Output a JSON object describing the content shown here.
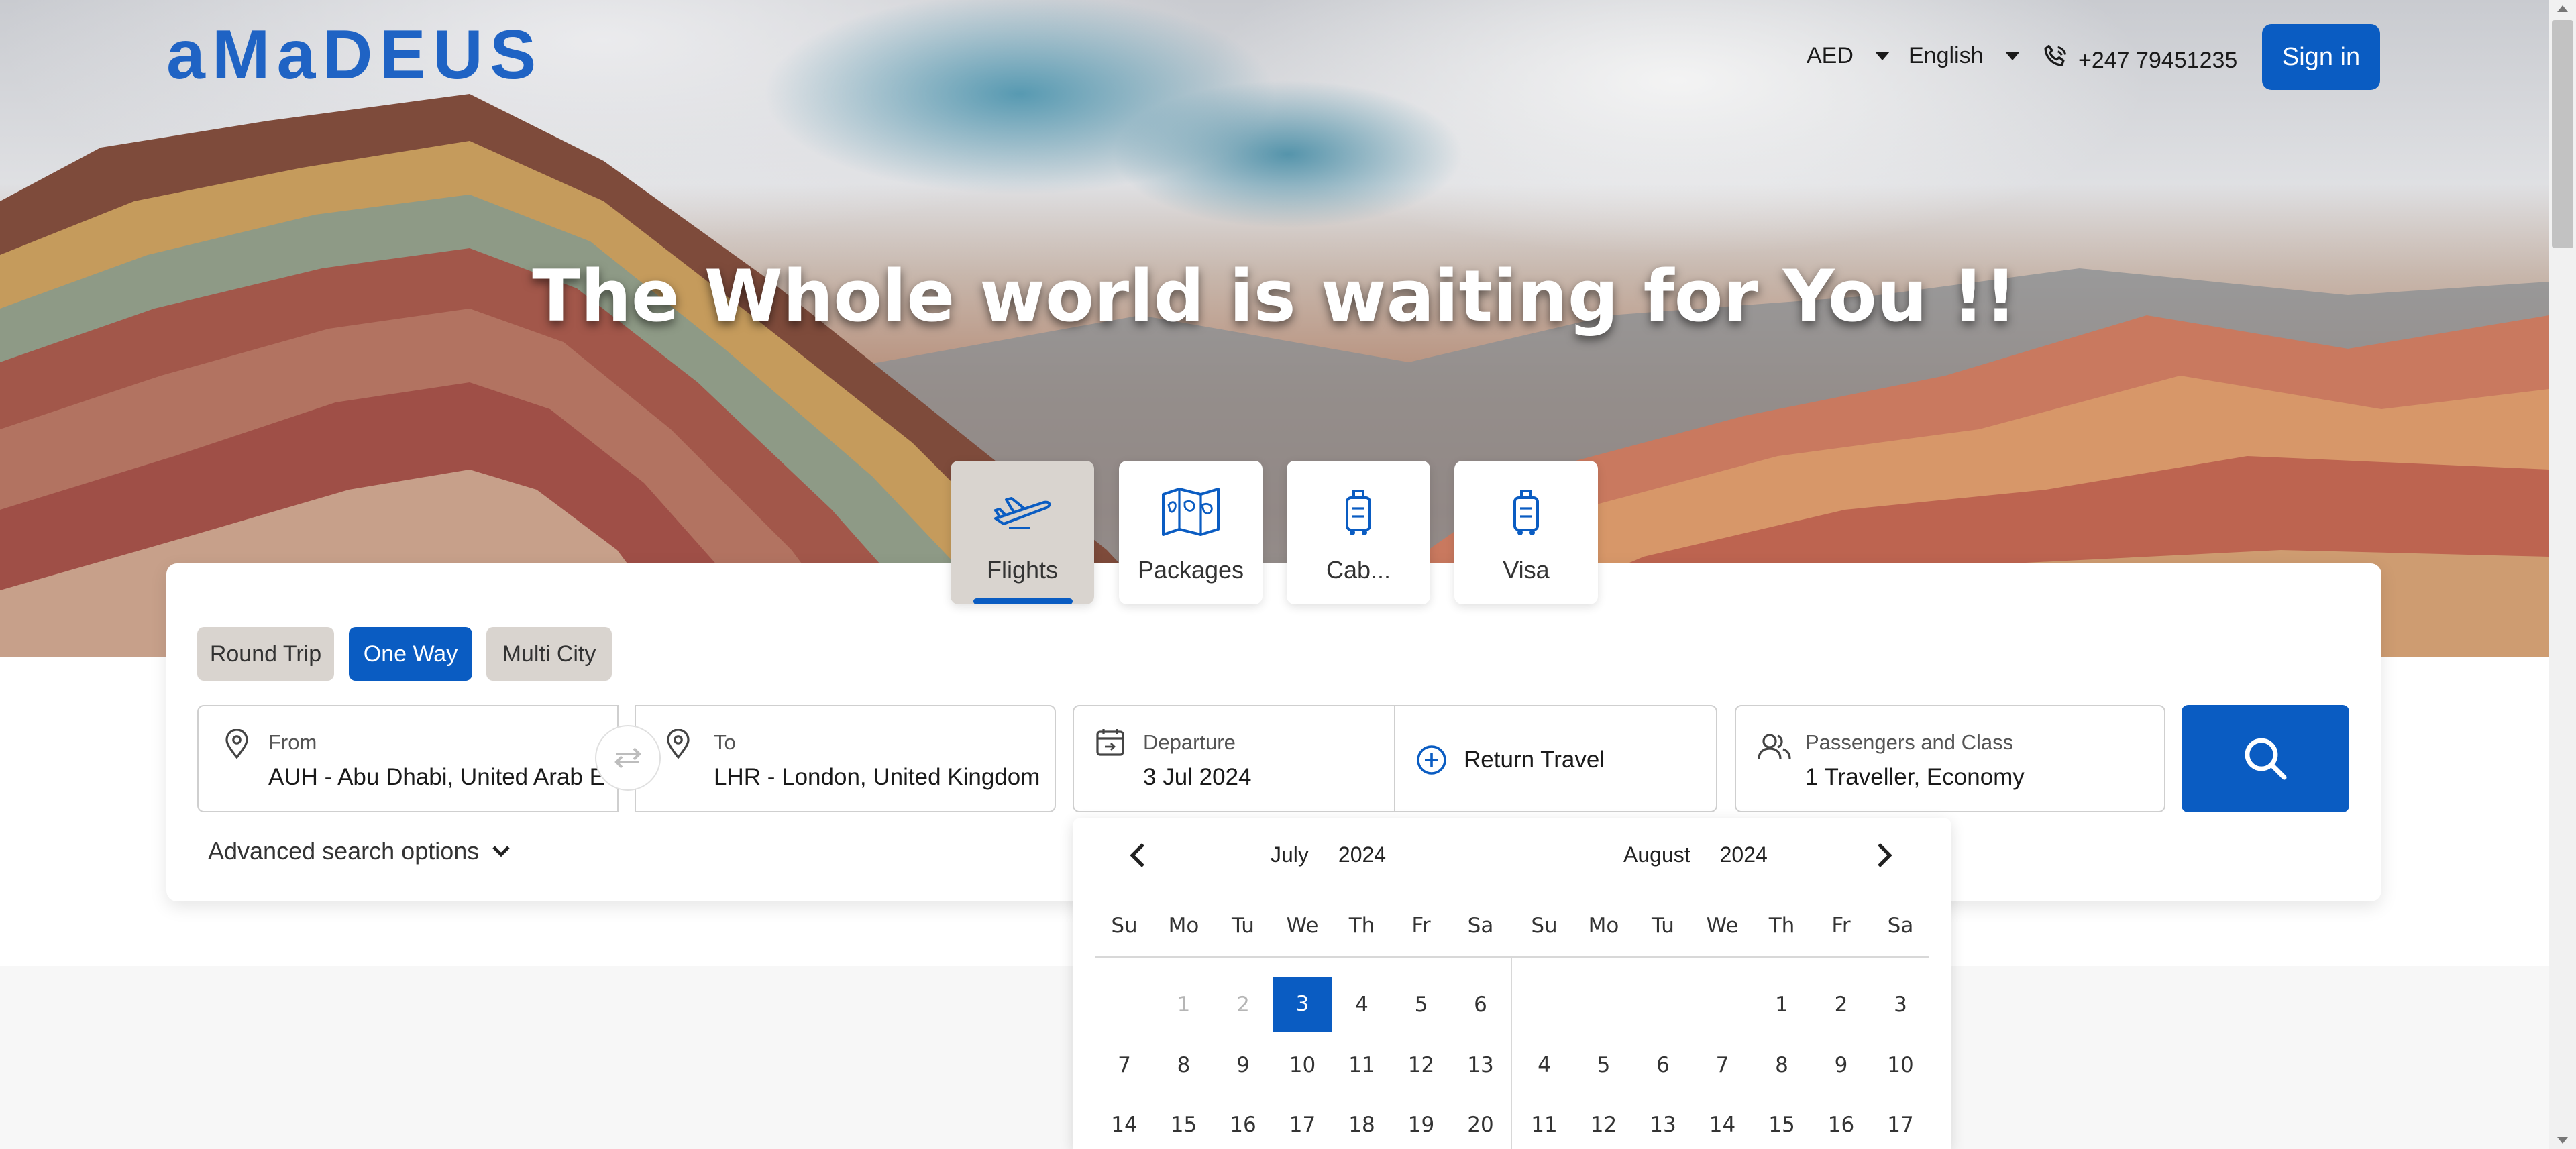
{
  "header": {
    "logo": "aMaDEUS",
    "currency": "AED",
    "language": "English",
    "phone": "+247 79451235",
    "signin_label": "Sign in"
  },
  "hero": {
    "headline": "The Whole world is waiting for You !!"
  },
  "product_tabs": [
    {
      "label": "Flights",
      "icon": "airplane-icon",
      "active": true
    },
    {
      "label": "Packages",
      "icon": "map-icon",
      "active": false
    },
    {
      "label": "Cab...",
      "icon": "luggage-icon",
      "active": false
    },
    {
      "label": "Visa",
      "icon": "luggage-icon",
      "active": false
    }
  ],
  "trip_types": [
    {
      "label": "Round Trip",
      "active": false
    },
    {
      "label": "One Way",
      "active": true
    },
    {
      "label": "Multi City",
      "active": false
    }
  ],
  "search": {
    "from_label": "From",
    "from_value": "AUH - Abu Dhabi, United Arab E...",
    "to_label": "To",
    "to_value": "LHR - London, United Kingdom",
    "departure_label": "Departure",
    "departure_value": "3 Jul 2024",
    "return_label": "Return Travel",
    "passengers_label": "Passengers and Class",
    "passengers_value": "1 Traveller, Economy",
    "advanced_label": "Advanced search options"
  },
  "calendar": {
    "weekdays": [
      "Su",
      "Mo",
      "Tu",
      "We",
      "Th",
      "Fr",
      "Sa"
    ],
    "months": [
      {
        "month": "July",
        "year": "2024",
        "rows": [
          [
            "",
            "1",
            "2",
            "3",
            "4",
            "5",
            "6"
          ],
          [
            "7",
            "8",
            "9",
            "10",
            "11",
            "12",
            "13"
          ],
          [
            "14",
            "15",
            "16",
            "17",
            "18",
            "19",
            "20"
          ]
        ],
        "disabled": [
          "1",
          "2"
        ],
        "selected": "3"
      },
      {
        "month": "August",
        "year": "2024",
        "rows": [
          [
            "",
            "",
            "",
            "",
            "1",
            "2",
            "3"
          ],
          [
            "4",
            "5",
            "6",
            "7",
            "8",
            "9",
            "10"
          ],
          [
            "11",
            "12",
            "13",
            "14",
            "15",
            "16",
            "17"
          ]
        ],
        "disabled": [],
        "selected": ""
      }
    ]
  },
  "colors": {
    "brand": "#0a5cc2",
    "logo": "#1f63c4",
    "tab_active_bg": "#d9d4cf"
  }
}
